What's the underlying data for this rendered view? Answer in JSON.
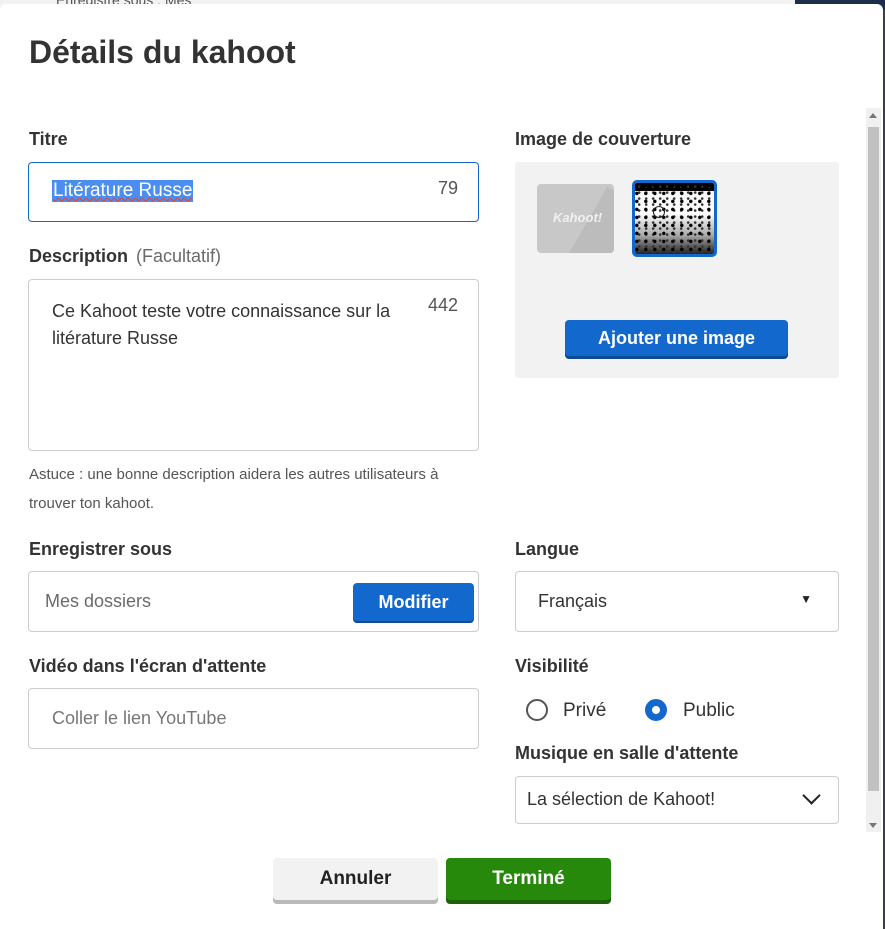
{
  "background": {
    "text": "Enregistré sous : Mes"
  },
  "modal": {
    "title": "Détails du kahoot",
    "title_field": {
      "label": "Titre",
      "value": "Litérature Russe",
      "counter": "79"
    },
    "description": {
      "label": "Description",
      "optional": "(Facultatif)",
      "value": "Ce Kahoot teste votre connaissance sur la litérature Russe",
      "counter": "442",
      "hint": "Astuce : une bonne description aidera les autres utilisateurs à trouver ton kahoot."
    },
    "cover": {
      "label": "Image de couverture",
      "default_thumb_text": "Kahoot!",
      "add_button": "Ajouter une image"
    },
    "save": {
      "label": "Enregistrer sous",
      "value": "Mes dossiers",
      "modify_button": "Modifier"
    },
    "language": {
      "label": "Langue",
      "value": "Français",
      "arrow": "▼"
    },
    "video": {
      "label": "Vidéo dans l'écran d'attente",
      "placeholder": "Coller le lien YouTube"
    },
    "visibility": {
      "label": "Visibilité",
      "options": [
        {
          "label": "Privé",
          "selected": false
        },
        {
          "label": "Public",
          "selected": true
        }
      ]
    },
    "music": {
      "label": "Musique en salle d'attente",
      "value": "La sélection de Kahoot!"
    },
    "buttons": {
      "cancel": "Annuler",
      "done": "Terminé"
    }
  },
  "colors": {
    "primary": "#1368ce",
    "success": "#26890c",
    "text": "#333333"
  }
}
